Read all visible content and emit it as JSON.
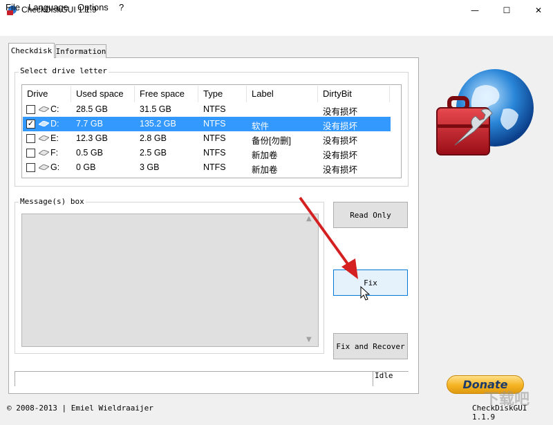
{
  "window": {
    "title": "CheckDiskGUI 1.1.9",
    "minimize_glyph": "—",
    "maximize_glyph": "☐",
    "close_glyph": "✕"
  },
  "menu": {
    "file": "File",
    "language": "Language",
    "options": "Options",
    "help": "?"
  },
  "tabs": {
    "checkdisk": "Checkdisk",
    "information": "Information"
  },
  "drive_group": {
    "label": "Select drive letter",
    "columns": [
      "Drive",
      "Used space",
      "Free space",
      "Type",
      "Label",
      "DirtyBit"
    ],
    "rows": [
      {
        "drive": "C:",
        "used": "28.5 GB",
        "free": "31.5 GB",
        "type": "NTFS",
        "label": "",
        "dirty": "没有损坏",
        "checked": false,
        "selected": false
      },
      {
        "drive": "D:",
        "used": "7.7 GB",
        "free": "135.2 GB",
        "type": "NTFS",
        "label": "软件",
        "dirty": "没有损坏",
        "checked": true,
        "selected": true
      },
      {
        "drive": "E:",
        "used": "12.3 GB",
        "free": "2.8 GB",
        "type": "NTFS",
        "label": "备份[勿删]",
        "dirty": "没有损坏",
        "checked": false,
        "selected": false
      },
      {
        "drive": "F:",
        "used": "0.5 GB",
        "free": "2.5 GB",
        "type": "NTFS",
        "label": "新加卷",
        "dirty": "没有损坏",
        "checked": false,
        "selected": false
      },
      {
        "drive": "G:",
        "used": "0 GB",
        "free": "3 GB",
        "type": "NTFS",
        "label": "新加卷",
        "dirty": "没有损坏",
        "checked": false,
        "selected": false
      }
    ]
  },
  "message_group": {
    "label": "Message(s) box",
    "content": ""
  },
  "buttons": {
    "read_only": "Read Only",
    "fix": "Fix",
    "fix_recover": "Fix and Recover",
    "donate": "Donate"
  },
  "status": {
    "text": "Idle"
  },
  "footer": {
    "copyright": "© 2008-2013 | Emiel Wieldraaijer",
    "version": "CheckDiskGUI 1.1.9"
  },
  "watermark": "下载吧",
  "colors": {
    "selection": "#3399ff",
    "accent": "#0078d7",
    "arrow": "#d42020",
    "logo_toolbox": "#c8202a"
  },
  "icons": {
    "app": "checkdisk-app-icon",
    "logo": "globe-toolbox-icon",
    "drive": "drive-icon",
    "cursor": "mouse-cursor-icon"
  }
}
